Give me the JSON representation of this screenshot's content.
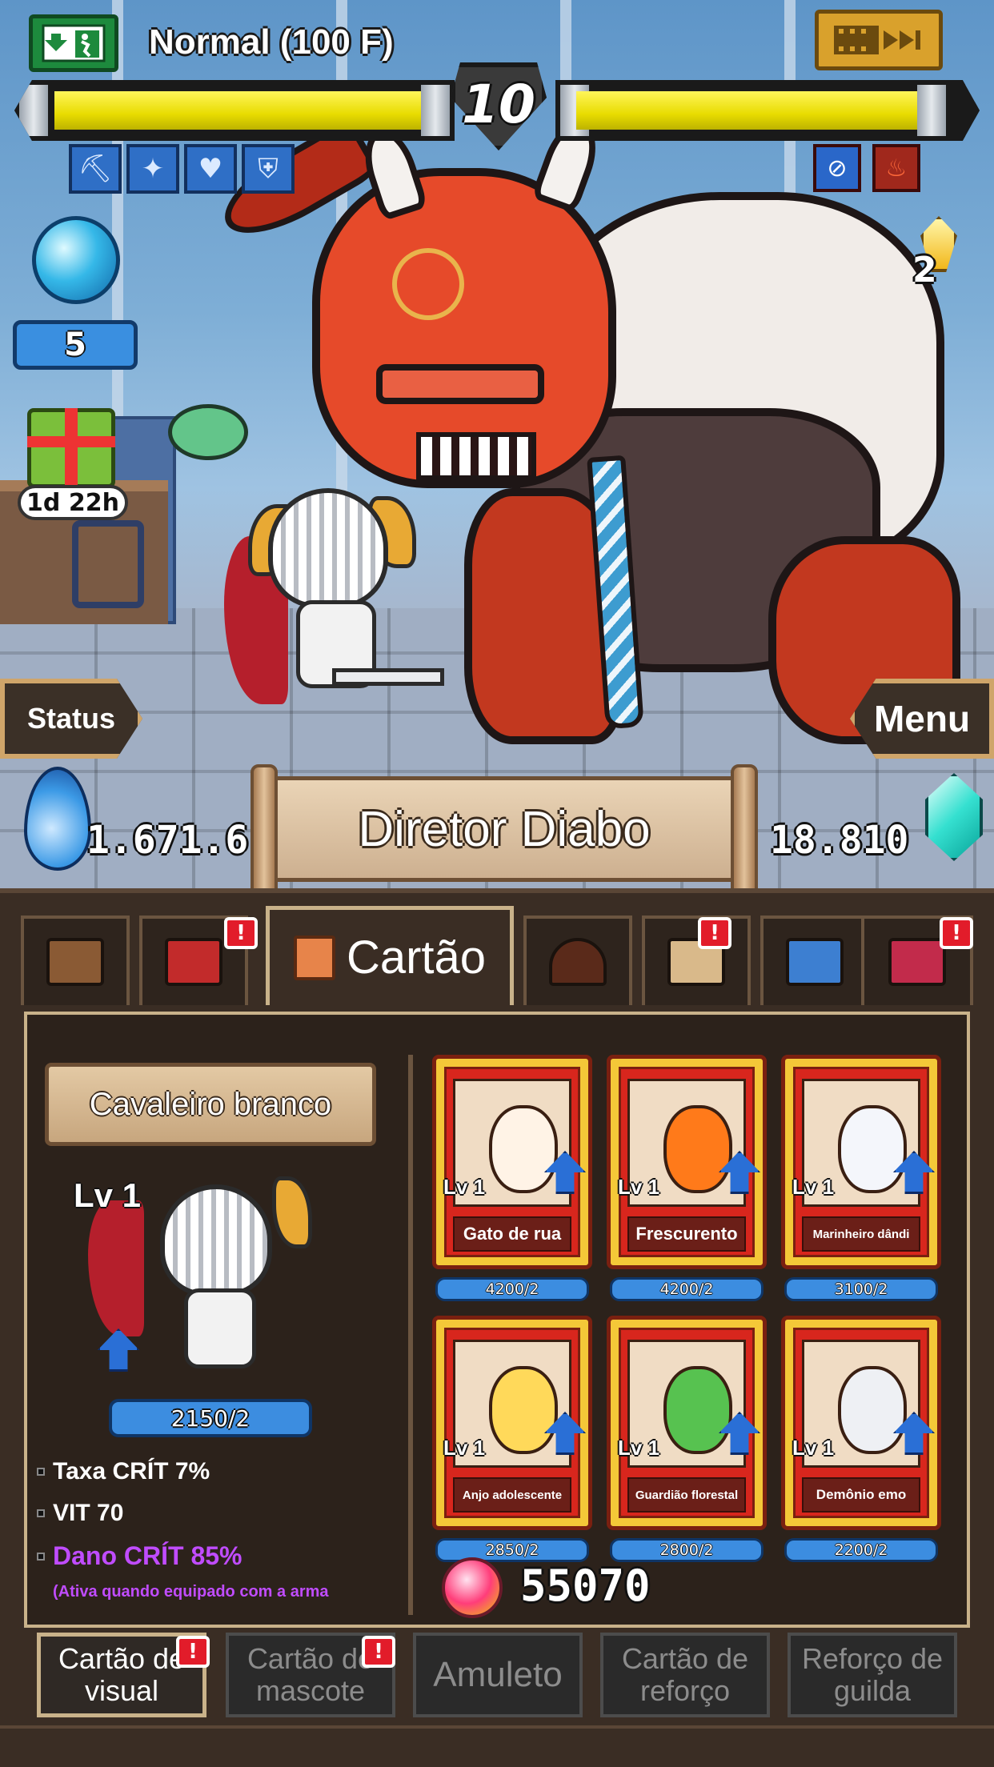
{
  "hud": {
    "stage_label": "Normal (100 F)",
    "round_number": "10",
    "orb_count": "5",
    "gift_timer": "1d 22h",
    "small_gem_count": "2",
    "status_button": "Status",
    "menu_button": "Menu",
    "drop_value": "1.671.6",
    "diamond_value": "18.810",
    "boss_name": "Diretor Diabo",
    "buffs": [
      "axe-buff-icon",
      "magic-wand-buff-icon",
      "heart-regen-buff-icon",
      "shield-buff-icon"
    ],
    "debuffs": [
      "no-skill-debuff-icon",
      "fire-debuff-icon"
    ]
  },
  "tabs": {
    "active_label": "Cartão",
    "icons": [
      "chest-tab",
      "level-up-tab",
      "cards-tab",
      "dungeon-tab",
      "scroll-tab",
      "guild-banner-tab",
      "treasure-tab"
    ]
  },
  "character": {
    "name": "Cavaleiro branco",
    "level": "Lv 1",
    "progress": "2150/2",
    "stats": {
      "crit_rate": "Taxa CRÍT 7%",
      "vit": "VIT 70",
      "crit_damage": "Dano CRÍT 85%",
      "note": "(Ativa quando equipado com a arma"
    }
  },
  "cards": [
    {
      "name": "Gato de rua",
      "level": "Lv 1",
      "progress": "4200/2"
    },
    {
      "name": "Frescurento",
      "level": "Lv 1",
      "progress": "4200/2"
    },
    {
      "name": "Marinheiro dândi",
      "level": "Lv 1",
      "progress": "3100/2"
    },
    {
      "name": "Anjo adolescente",
      "level": "Lv 1",
      "progress": "2850/2"
    },
    {
      "name": "Guardião florestal",
      "level": "Lv 1",
      "progress": "2800/2"
    },
    {
      "name": "Demônio emo",
      "level": "Lv 1",
      "progress": "2200/2"
    }
  ],
  "currency": {
    "value": "55070"
  },
  "bottom_tabs": [
    {
      "label": "Cartão de visual"
    },
    {
      "label": "Cartão de mascote"
    },
    {
      "label": "Amuleto"
    },
    {
      "label": "Cartão de reforço"
    },
    {
      "label": "Reforço de guilda"
    }
  ],
  "alert_mark": "!"
}
